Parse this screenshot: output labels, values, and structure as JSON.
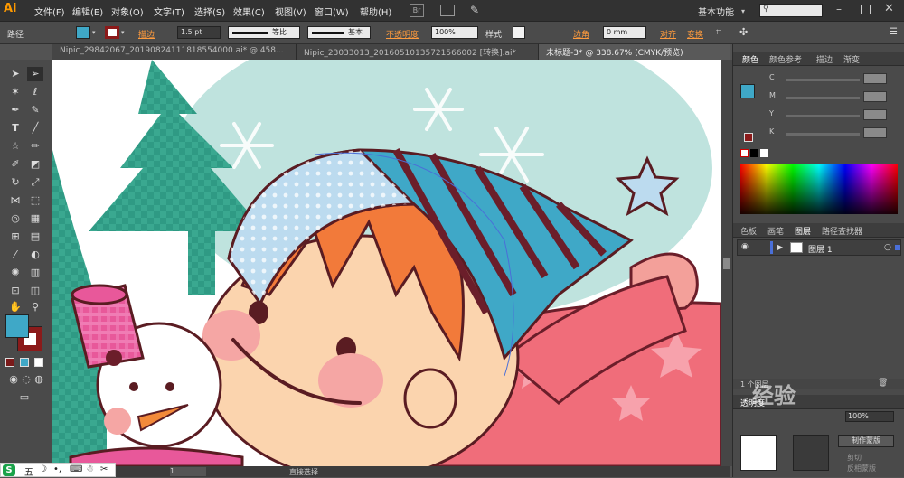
{
  "menubar": {
    "logo": "Ai",
    "items": [
      "文件(F)",
      "编辑(E)",
      "对象(O)",
      "文字(T)",
      "选择(S)",
      "效果(C)",
      "视图(V)",
      "窗口(W)",
      "帮助(H)"
    ],
    "br_label": "Br",
    "workspace": "基本功能",
    "search_placeholder": ""
  },
  "controlbar": {
    "object_type": "路径",
    "stroke_label": "描边",
    "stroke_value": "1.5 pt",
    "profile1": "等比",
    "profile2": "基本",
    "opacity_label": "不透明度",
    "opacity_value": "100%",
    "style_label": "样式",
    "corner_label": "边角",
    "corner_value": "0 mm",
    "align_label": "对齐",
    "transform_label": "变换",
    "fill_color": "#3fa8c7",
    "stroke_color": "#8b1a1a"
  },
  "tabs": [
    {
      "label": "Nipic_29842067_20190824111818554000.ai* @ 458...",
      "active": false
    },
    {
      "label": "Nipic_23033013_20160510135721566002 [转换].ai*",
      "active": false
    },
    {
      "label": "未标题-3* @ 338.67% (CMYK/预览)",
      "active": true
    }
  ],
  "color_panel": {
    "tabs": [
      "颜色",
      "颜色参考",
      "描边",
      "渐变"
    ],
    "channels": [
      {
        "label": "C",
        "value": ""
      },
      {
        "label": "M",
        "value": ""
      },
      {
        "label": "Y",
        "value": ""
      },
      {
        "label": "K",
        "value": ""
      }
    ]
  },
  "layers_panel": {
    "tabs": [
      "色板",
      "画笔",
      "图层",
      "路径查找器"
    ],
    "layer_name": "图层 1",
    "footer_count": "1 个图层"
  },
  "transparency_panel": {
    "tab": "透明度",
    "opacity": "100%",
    "make_mask": "制作蒙版",
    "clip": "剪切",
    "invert": "反相蒙版"
  },
  "status": {
    "tool_name": "直接选择",
    "page": "1"
  },
  "ime": {
    "logo": "S",
    "mode": "五"
  },
  "watermark": "经验"
}
